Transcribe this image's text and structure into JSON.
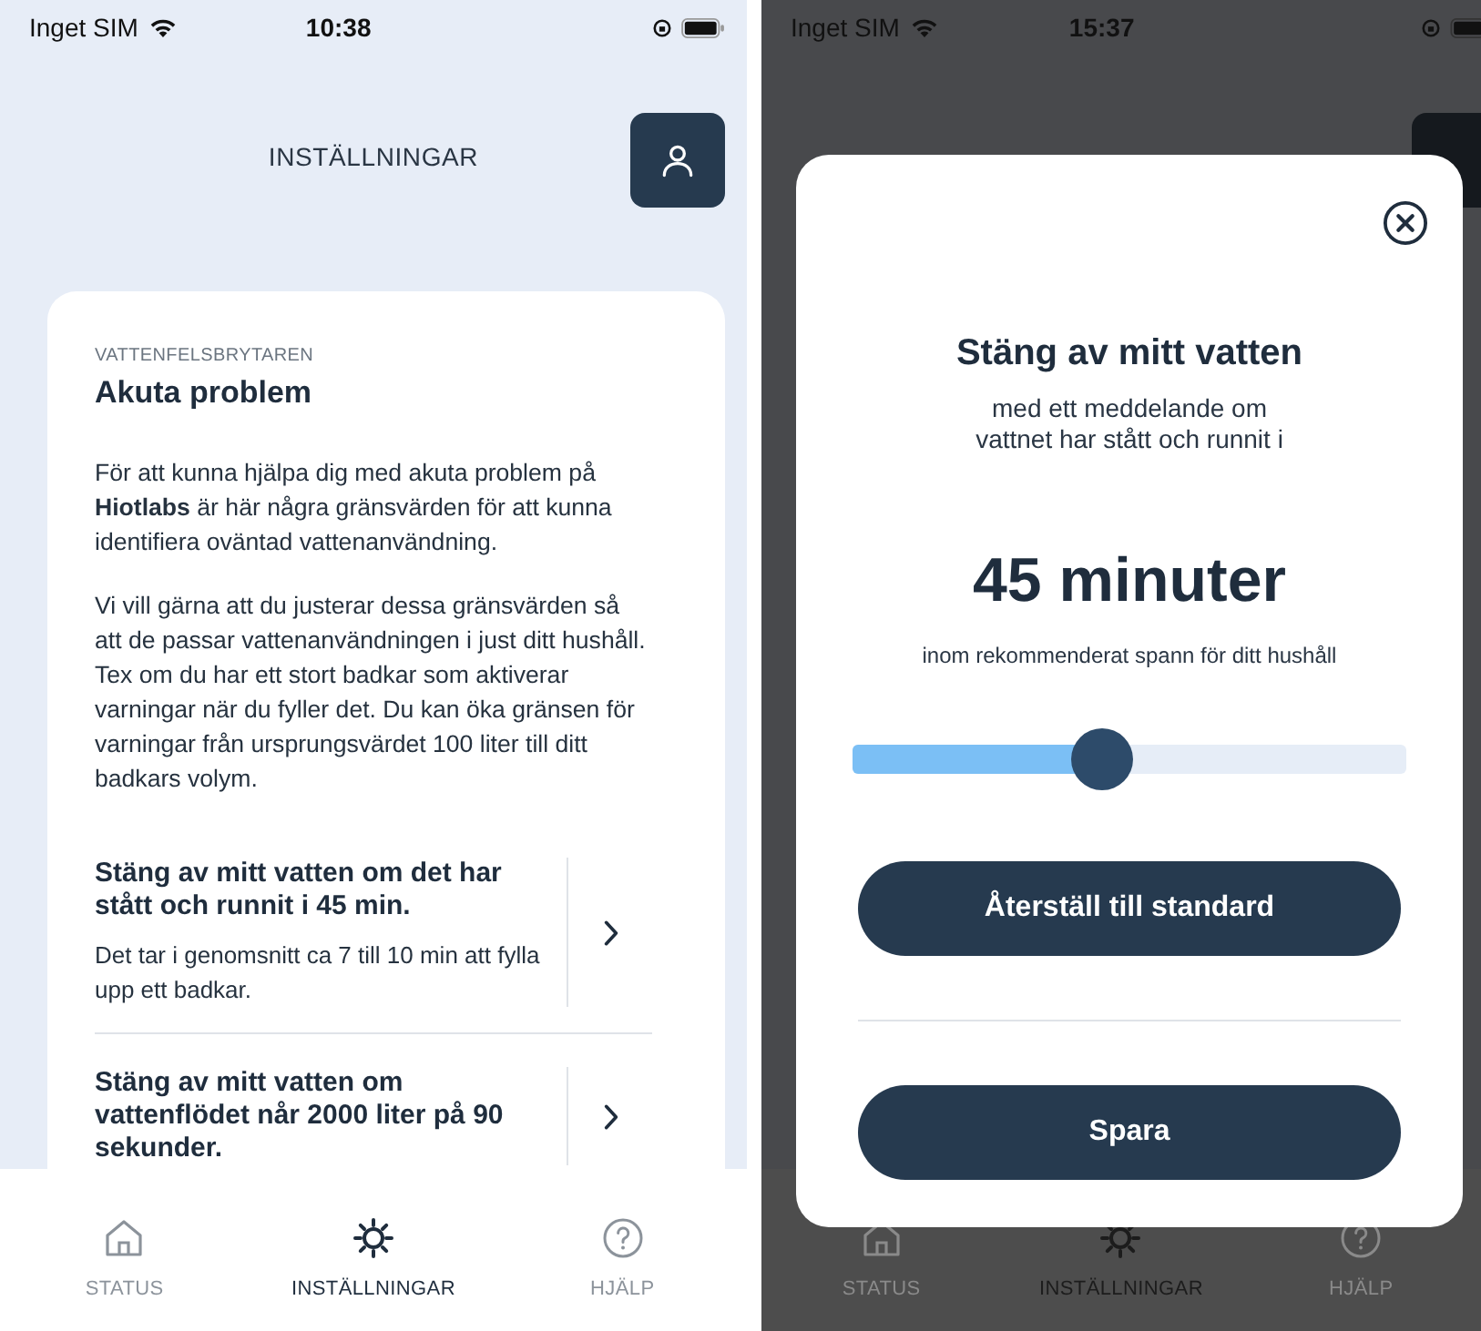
{
  "settings_screen": {
    "status_bar": {
      "carrier": "Inget SIM",
      "time": "10:38"
    },
    "header": {
      "title": "INSTÄLLNINGAR"
    },
    "card": {
      "eyebrow": "VATTENFELSBRYTAREN",
      "title": "Akuta problem",
      "paragraphs": [
        "För att kunna hjälpa dig med akuta problem på **Hiotlabs** är här några gränsvärden för att kunna identifiera oväntad vattenanvändning.",
        "Vi vill gärna att du justerar dessa gränsvärden så att de passar vattenanvändningen i just ditt hushåll. Tex om du har ett stort badkar som aktiverar varningar när du fyller det. Du kan öka gränsen för varningar från ursprungsvärdet 100 liter till ditt badkars volym."
      ]
    },
    "settings": [
      {
        "title": "Stäng av mitt vatten om det har stått och runnit i 45 min.",
        "description": "Det tar i genomsnitt ca 7 till 10 min att fylla upp ett badkar."
      },
      {
        "title": "Stäng av mitt vatten om vattenflödet når 2000 liter på 90 sekunder."
      }
    ],
    "tab_bar": [
      {
        "kind": "home",
        "label": "STATUS",
        "selected": false
      },
      {
        "kind": "gear",
        "label": "INSTÄLLNINGAR",
        "selected": true
      },
      {
        "kind": "help",
        "label": "HJÄLP",
        "selected": false
      }
    ]
  },
  "modal_screen": {
    "status_bar": {
      "carrier": "Inget SIM",
      "time": "15:37"
    },
    "dialog": {
      "title": "Stäng av mitt vatten",
      "subtitle": "med ett meddelande om vattnet har stått och runnit i",
      "value": "45 minuter",
      "hint": "inom rekommenderat spann för ditt hushåll",
      "slider": {
        "level": 0.45
      },
      "buttons": [
        "Återställ till standard",
        "Spara"
      ]
    },
    "tab_bar": [
      {
        "kind": "home",
        "label": "STATUS",
        "selected": false
      },
      {
        "kind": "gear",
        "label": "INSTÄLLNINGAR",
        "selected": true
      },
      {
        "kind": "help",
        "label": "HJÄLP",
        "selected": false
      }
    ]
  }
}
